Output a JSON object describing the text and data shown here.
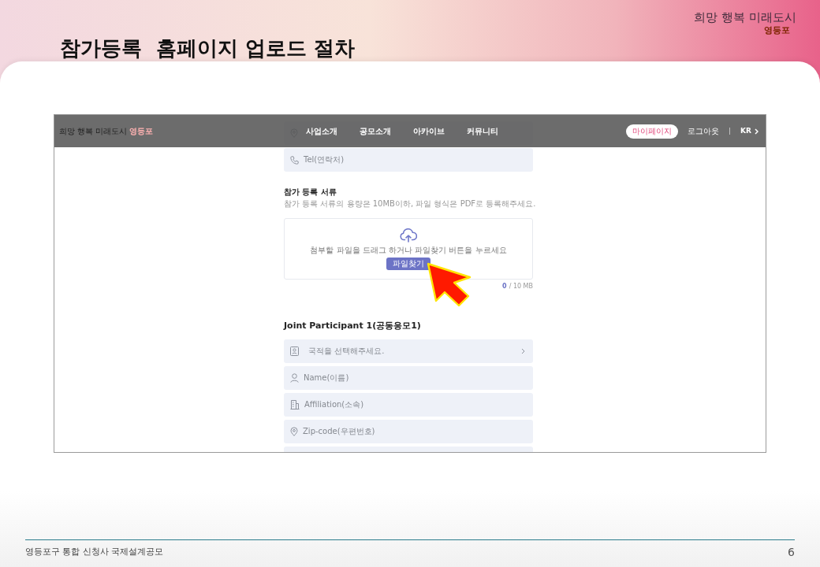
{
  "slide": {
    "title": "참가등록  홈페이지 업로드 절차",
    "logo": {
      "wordmark": "희망 행복 미래도시",
      "district": "영등포"
    }
  },
  "screenshot": {
    "nav": {
      "logo": {
        "wordmark": "희망 행복 미래도시",
        "district": "영등포"
      },
      "menu": [
        {
          "label": "사업소개"
        },
        {
          "label": "공모소개"
        },
        {
          "label": "아카이브"
        },
        {
          "label": "커뮤니티"
        }
      ],
      "mypage": "마이페이지",
      "logout": "로그아웃",
      "separator": "|",
      "language": "KR"
    },
    "contact_fields": [
      {
        "kind": "address"
      },
      {
        "kind": "tel",
        "placeholder": "Tel(연락처)"
      }
    ],
    "documents": {
      "heading": "참가 등록 서류",
      "note": "참가 등록 서류의 용량은 10MB이하, 파일 형식은 PDF로 등록해주세요.",
      "dropzone": {
        "message": "첨부할 파일을 드래그 하거나 파일찾기 버튼을 누르세요",
        "button": "파일찾기"
      },
      "used": "0",
      "limit": "/ 10 MB"
    },
    "joint_participant": {
      "heading": "Joint Participant 1(공동응모1)",
      "fields": [
        {
          "kind": "nationality",
          "placeholder": "국적을 선택해주세요."
        },
        {
          "kind": "name",
          "placeholder": "Name(이름)"
        },
        {
          "kind": "affiliation",
          "placeholder": "Affiliation(소속)"
        },
        {
          "kind": "zipcode",
          "placeholder": "Zip-code(우편번호)"
        },
        {
          "kind": "other"
        }
      ]
    }
  },
  "footer": {
    "text": "영등포구 통합 신청사 국제설계공모",
    "page": "6"
  }
}
